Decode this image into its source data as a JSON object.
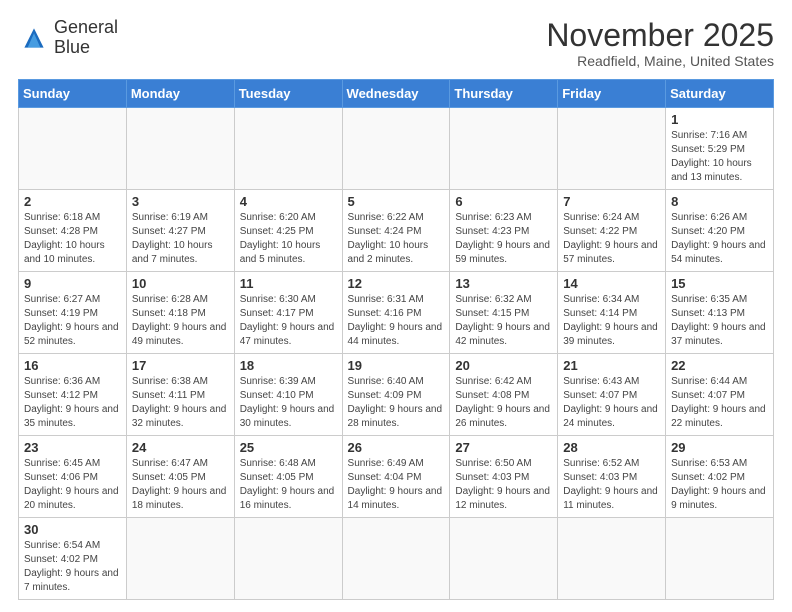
{
  "logo": {
    "general": "General",
    "blue": "Blue"
  },
  "header": {
    "month": "November 2025",
    "location": "Readfield, Maine, United States"
  },
  "weekdays": [
    "Sunday",
    "Monday",
    "Tuesday",
    "Wednesday",
    "Thursday",
    "Friday",
    "Saturday"
  ],
  "weeks": [
    [
      {
        "day": "",
        "info": ""
      },
      {
        "day": "",
        "info": ""
      },
      {
        "day": "",
        "info": ""
      },
      {
        "day": "",
        "info": ""
      },
      {
        "day": "",
        "info": ""
      },
      {
        "day": "",
        "info": ""
      },
      {
        "day": "1",
        "info": "Sunrise: 7:16 AM\nSunset: 5:29 PM\nDaylight: 10 hours\nand 13 minutes."
      }
    ],
    [
      {
        "day": "2",
        "info": "Sunrise: 6:18 AM\nSunset: 4:28 PM\nDaylight: 10 hours\nand 10 minutes."
      },
      {
        "day": "3",
        "info": "Sunrise: 6:19 AM\nSunset: 4:27 PM\nDaylight: 10 hours\nand 7 minutes."
      },
      {
        "day": "4",
        "info": "Sunrise: 6:20 AM\nSunset: 4:25 PM\nDaylight: 10 hours\nand 5 minutes."
      },
      {
        "day": "5",
        "info": "Sunrise: 6:22 AM\nSunset: 4:24 PM\nDaylight: 10 hours\nand 2 minutes."
      },
      {
        "day": "6",
        "info": "Sunrise: 6:23 AM\nSunset: 4:23 PM\nDaylight: 9 hours\nand 59 minutes."
      },
      {
        "day": "7",
        "info": "Sunrise: 6:24 AM\nSunset: 4:22 PM\nDaylight: 9 hours\nand 57 minutes."
      },
      {
        "day": "8",
        "info": "Sunrise: 6:26 AM\nSunset: 4:20 PM\nDaylight: 9 hours\nand 54 minutes."
      }
    ],
    [
      {
        "day": "9",
        "info": "Sunrise: 6:27 AM\nSunset: 4:19 PM\nDaylight: 9 hours\nand 52 minutes."
      },
      {
        "day": "10",
        "info": "Sunrise: 6:28 AM\nSunset: 4:18 PM\nDaylight: 9 hours\nand 49 minutes."
      },
      {
        "day": "11",
        "info": "Sunrise: 6:30 AM\nSunset: 4:17 PM\nDaylight: 9 hours\nand 47 minutes."
      },
      {
        "day": "12",
        "info": "Sunrise: 6:31 AM\nSunset: 4:16 PM\nDaylight: 9 hours\nand 44 minutes."
      },
      {
        "day": "13",
        "info": "Sunrise: 6:32 AM\nSunset: 4:15 PM\nDaylight: 9 hours\nand 42 minutes."
      },
      {
        "day": "14",
        "info": "Sunrise: 6:34 AM\nSunset: 4:14 PM\nDaylight: 9 hours\nand 39 minutes."
      },
      {
        "day": "15",
        "info": "Sunrise: 6:35 AM\nSunset: 4:13 PM\nDaylight: 9 hours\nand 37 minutes."
      }
    ],
    [
      {
        "day": "16",
        "info": "Sunrise: 6:36 AM\nSunset: 4:12 PM\nDaylight: 9 hours\nand 35 minutes."
      },
      {
        "day": "17",
        "info": "Sunrise: 6:38 AM\nSunset: 4:11 PM\nDaylight: 9 hours\nand 32 minutes."
      },
      {
        "day": "18",
        "info": "Sunrise: 6:39 AM\nSunset: 4:10 PM\nDaylight: 9 hours\nand 30 minutes."
      },
      {
        "day": "19",
        "info": "Sunrise: 6:40 AM\nSunset: 4:09 PM\nDaylight: 9 hours\nand 28 minutes."
      },
      {
        "day": "20",
        "info": "Sunrise: 6:42 AM\nSunset: 4:08 PM\nDaylight: 9 hours\nand 26 minutes."
      },
      {
        "day": "21",
        "info": "Sunrise: 6:43 AM\nSunset: 4:07 PM\nDaylight: 9 hours\nand 24 minutes."
      },
      {
        "day": "22",
        "info": "Sunrise: 6:44 AM\nSunset: 4:07 PM\nDaylight: 9 hours\nand 22 minutes."
      }
    ],
    [
      {
        "day": "23",
        "info": "Sunrise: 6:45 AM\nSunset: 4:06 PM\nDaylight: 9 hours\nand 20 minutes."
      },
      {
        "day": "24",
        "info": "Sunrise: 6:47 AM\nSunset: 4:05 PM\nDaylight: 9 hours\nand 18 minutes."
      },
      {
        "day": "25",
        "info": "Sunrise: 6:48 AM\nSunset: 4:05 PM\nDaylight: 9 hours\nand 16 minutes."
      },
      {
        "day": "26",
        "info": "Sunrise: 6:49 AM\nSunset: 4:04 PM\nDaylight: 9 hours\nand 14 minutes."
      },
      {
        "day": "27",
        "info": "Sunrise: 6:50 AM\nSunset: 4:03 PM\nDaylight: 9 hours\nand 12 minutes."
      },
      {
        "day": "28",
        "info": "Sunrise: 6:52 AM\nSunset: 4:03 PM\nDaylight: 9 hours\nand 11 minutes."
      },
      {
        "day": "29",
        "info": "Sunrise: 6:53 AM\nSunset: 4:02 PM\nDaylight: 9 hours\nand 9 minutes."
      }
    ],
    [
      {
        "day": "30",
        "info": "Sunrise: 6:54 AM\nSunset: 4:02 PM\nDaylight: 9 hours\nand 7 minutes."
      },
      {
        "day": "",
        "info": ""
      },
      {
        "day": "",
        "info": ""
      },
      {
        "day": "",
        "info": ""
      },
      {
        "day": "",
        "info": ""
      },
      {
        "day": "",
        "info": ""
      },
      {
        "day": "",
        "info": ""
      }
    ]
  ]
}
